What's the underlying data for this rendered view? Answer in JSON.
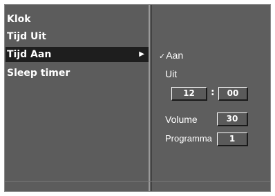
{
  "menu": {
    "items": [
      {
        "label": "Klok"
      },
      {
        "label": "Tijd Uit"
      },
      {
        "label": "Tijd Aan",
        "arrow": "▶"
      },
      {
        "label": "Sleep timer"
      }
    ],
    "selected_index": 2
  },
  "panel": {
    "on_option": {
      "label": "Aan",
      "check": "✓"
    },
    "off_option": {
      "label": "Uit"
    },
    "time": {
      "hour": "12",
      "separator": ":",
      "minute": "00"
    },
    "volume": {
      "label": "Volume",
      "value": "30"
    },
    "program": {
      "label": "Programma",
      "value": "1"
    }
  },
  "colors": {
    "background": "#5c5c5c",
    "selected": "#1e1e1e",
    "text": "#ffffff"
  }
}
